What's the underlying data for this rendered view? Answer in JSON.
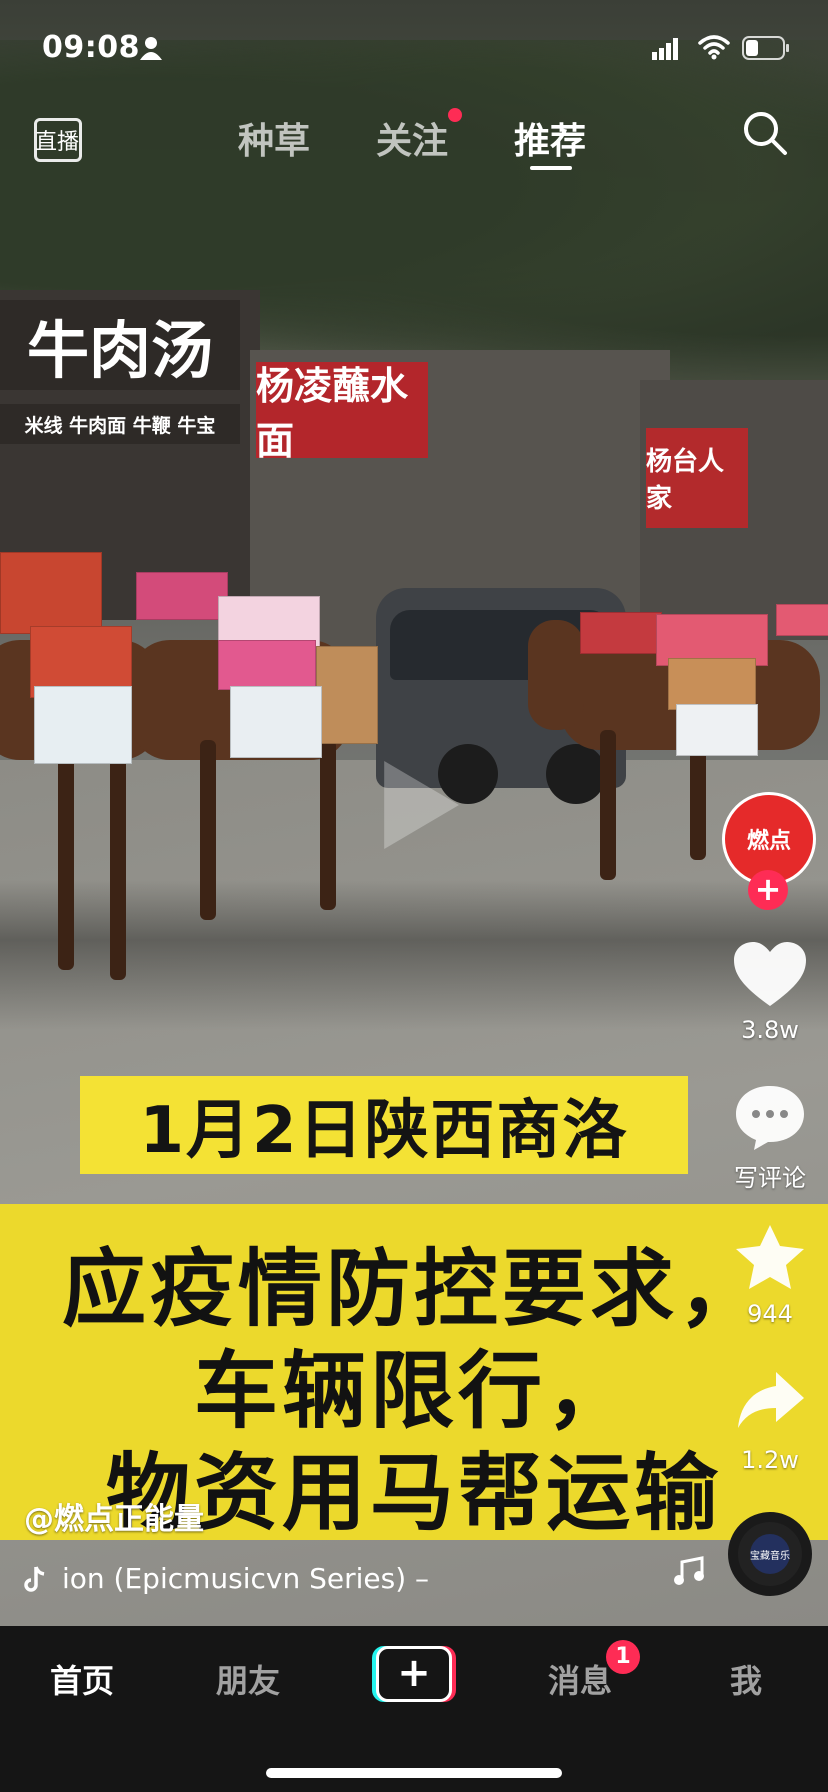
{
  "status_bar": {
    "time": "09:08"
  },
  "top_nav": {
    "live_label": "直播",
    "tabs": [
      {
        "label": "种草",
        "active": false,
        "has_dot": false
      },
      {
        "label": "关注",
        "active": false,
        "has_dot": true
      },
      {
        "label": "推荐",
        "active": true,
        "has_dot": false
      }
    ]
  },
  "video": {
    "shop_signs": [
      "牛肉汤",
      "杨凌蘸水面",
      "杨台人家"
    ],
    "shop_subsign": "米线 牛肉面 牛鞭 牛宝",
    "caption_title": "1月2日陕西商洛",
    "caption_lines": [
      "应疫情防控要求，",
      "车辆限行，",
      "物资用马帮运输"
    ]
  },
  "right_rail": {
    "avatar_text": "燃点",
    "follow_symbol": "+",
    "like_count": "3.8w",
    "comment_label": "写评论",
    "favorite_count": "944",
    "share_count": "1.2w",
    "disc_text": "宝藏音乐"
  },
  "author": {
    "handle": "@燃点正能量"
  },
  "music": {
    "title": "ion (Epicmusicvn Series) –"
  },
  "bottom_bar": {
    "tabs": [
      {
        "label": "首页",
        "active": true
      },
      {
        "label": "朋友",
        "active": false
      },
      {
        "label": "消息",
        "active": false
      },
      {
        "label": "我",
        "active": false
      }
    ],
    "add_symbol": "+",
    "message_badge": "1"
  },
  "colors": {
    "accent": "#fe2c55",
    "caption_yellow": "#f4e234",
    "bottom_bar_bg": "#151515"
  }
}
